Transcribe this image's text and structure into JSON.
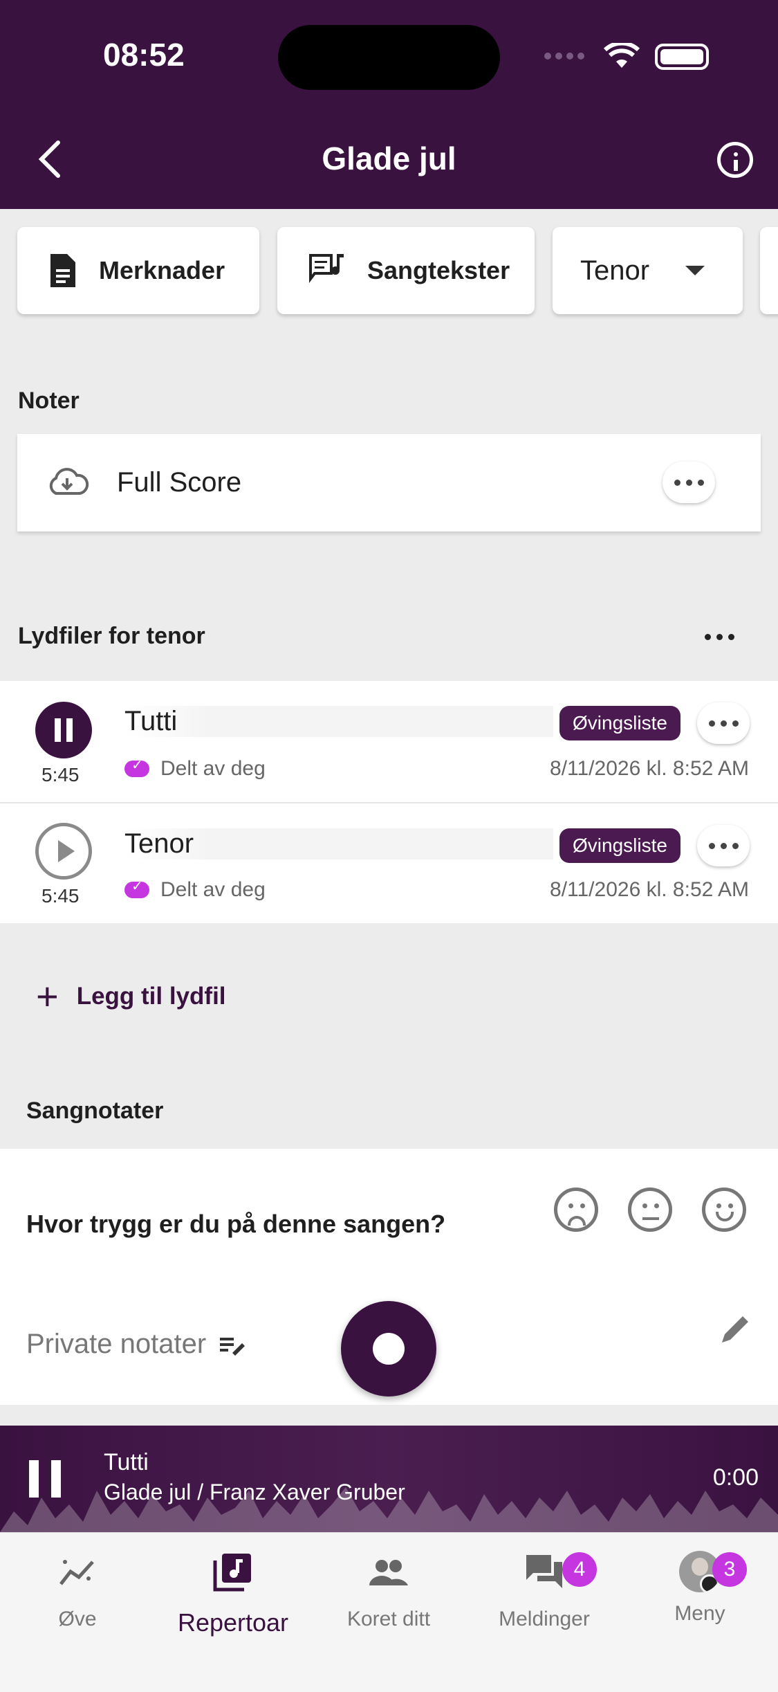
{
  "status": {
    "time": "08:52"
  },
  "header": {
    "title": "Glade jul"
  },
  "chips": {
    "notes": "Merknader",
    "lyrics": "Sangtekster",
    "voice": "Tenor"
  },
  "noter": {
    "label": "Noter",
    "item": "Full Score"
  },
  "audio": {
    "label": "Lydfiler for tenor",
    "items": [
      {
        "name": "Tutti",
        "duration": "5:45",
        "badge": "Øvingsliste",
        "shared": "Delt av deg",
        "date": "8/11/2026 kl. 8:52 AM",
        "playing": true
      },
      {
        "name": "Tenor",
        "duration": "5:45",
        "badge": "Øvingsliste",
        "shared": "Delt av deg",
        "date": "8/11/2026 kl. 8:52 AM",
        "playing": false
      }
    ],
    "add_label": "Legg til lydfil"
  },
  "song_notes": {
    "label": "Sangnotater",
    "question": "Hvor trygg er du på denne sangen?",
    "private_placeholder": "Private notater"
  },
  "player": {
    "title": "Tutti",
    "subtitle": "Glade jul / Franz Xaver Gruber",
    "time": "0:00"
  },
  "tabs": [
    {
      "label": "Øve",
      "icon": "practice-icon"
    },
    {
      "label": "Repertoar",
      "icon": "repertoire-icon",
      "active": true
    },
    {
      "label": "Koret ditt",
      "icon": "group-icon"
    },
    {
      "label": "Meldinger",
      "icon": "chat-icon",
      "badge": "4"
    },
    {
      "label": "Meny",
      "icon": "avatar",
      "badge": "3"
    }
  ],
  "colors": {
    "brand": "#3a1240",
    "accent": "#c536e0"
  }
}
